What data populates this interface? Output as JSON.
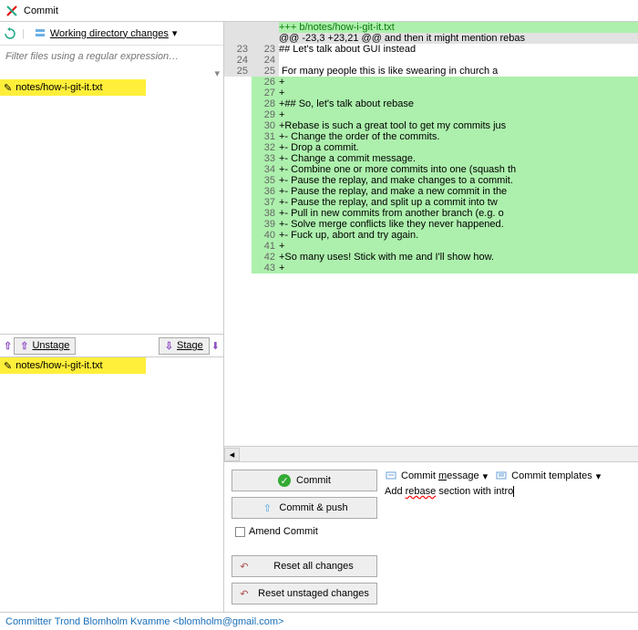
{
  "window": {
    "title": "Commit"
  },
  "left": {
    "working_changes_label": "Working directory changes",
    "filter_placeholder": "Filter files using a regular expression…",
    "unstaged_file": "notes/how-i-git-it.txt",
    "staged_file": "notes/how-i-git-it.txt",
    "unstage_label": "Unstage",
    "stage_label": "Stage"
  },
  "diff": {
    "header1": "+++ b/notes/how-i-git-it.txt",
    "hunk": "@@ -23,3 +23,21 @@ and then it might mention rebas",
    "lines": [
      {
        "ol": "23",
        "nl": "23",
        "type": "ctx",
        "text": "## Let's talk about GUI instead"
      },
      {
        "ol": "24",
        "nl": "24",
        "type": "ctx",
        "text": ""
      },
      {
        "ol": "25",
        "nl": "25",
        "type": "ctx",
        "text": " For many people this is like swearing in church a"
      },
      {
        "ol": "",
        "nl": "26",
        "type": "add",
        "text": "+"
      },
      {
        "ol": "",
        "nl": "27",
        "type": "add",
        "text": "+"
      },
      {
        "ol": "",
        "nl": "28",
        "type": "add",
        "text": "+## So, let's talk about rebase  "
      },
      {
        "ol": "",
        "nl": "29",
        "type": "add",
        "text": "+"
      },
      {
        "ol": "",
        "nl": "30",
        "type": "add",
        "text": "+Rebase is such a great tool to get my commits jus"
      },
      {
        "ol": "",
        "nl": "31",
        "type": "add",
        "text": "+- Change the order of the commits.  "
      },
      {
        "ol": "",
        "nl": "32",
        "type": "add",
        "text": "+- Drop a commit."
      },
      {
        "ol": "",
        "nl": "33",
        "type": "add",
        "text": "+- Change a commit message."
      },
      {
        "ol": "",
        "nl": "34",
        "type": "add",
        "text": "+- Combine one or more commits into one (squash th"
      },
      {
        "ol": "",
        "nl": "35",
        "type": "add",
        "text": "+- Pause the replay, and make changes to a commit."
      },
      {
        "ol": "",
        "nl": "36",
        "type": "add",
        "text": "+- Pause the replay, and make a new commit in the "
      },
      {
        "ol": "",
        "nl": "37",
        "type": "add",
        "text": "+- Pause the replay, and split up a commit into tw"
      },
      {
        "ol": "",
        "nl": "38",
        "type": "add",
        "text": "+- Pull in new commits from another branch (e.g. o"
      },
      {
        "ol": "",
        "nl": "39",
        "type": "add",
        "text": "+- Solve merge conflicts like they never happened."
      },
      {
        "ol": "",
        "nl": "40",
        "type": "add",
        "text": "+- Fuck up, abort and try again."
      },
      {
        "ol": "",
        "nl": "41",
        "type": "add",
        "text": "+"
      },
      {
        "ol": "",
        "nl": "42",
        "type": "add",
        "text": "+So many uses! Stick with me and I'll show how."
      },
      {
        "ol": "",
        "nl": "43",
        "type": "add",
        "text": "+"
      }
    ]
  },
  "commit": {
    "commit_label": "Commit",
    "commit_push_label": "Commit & push",
    "amend_label": "Amend Commit",
    "reset_all_label": "Reset all changes",
    "reset_unstaged_label": "Reset unstaged changes",
    "msg_label": "Commit message",
    "tmpl_label": "Commit templates",
    "msg_value": "Add rebase section with intro"
  },
  "status": {
    "committer_label": "Committer",
    "committer_name": "Trond Blomholm Kvamme",
    "committer_email": "<blomholm@gmail.com>"
  }
}
